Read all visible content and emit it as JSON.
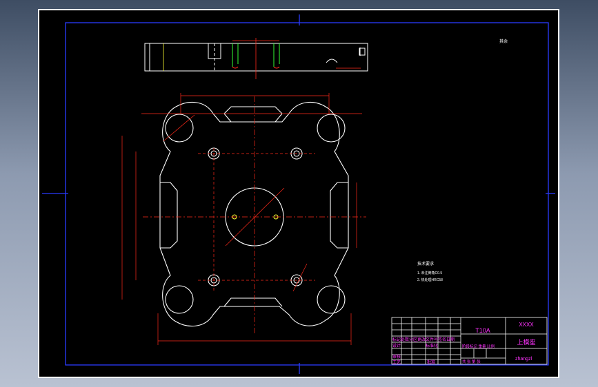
{
  "drawing": {
    "material": "T10A",
    "drawing_no": "XXXX",
    "part_name": "上模座",
    "author": "zhangzl",
    "scale_note": "其余",
    "tech_req_title": "技术要求",
    "tech_req_1": "1. 未注倒角C0.5",
    "tech_req_2": "2. 热处理HRC58",
    "tb_row1": "标记处数分区更改文件号签名日期",
    "tb_row2_left": "设计",
    "tb_row2_mid": "标准化",
    "tb_row3_left": "审核",
    "tb_row4_left": "工艺",
    "tb_row4_mid": "批准",
    "tb_stage": "阶段标记 重量 比例",
    "tb_sheet": "共 张 第 张"
  },
  "colors": {
    "background": "#000000",
    "border": "#ffffff",
    "frame": "#2a3bff",
    "geometry": "#ffffff",
    "dimension": "#ff2a1a",
    "centerline": "#ff2a1a",
    "hidden": "#ffff33",
    "title_block": "#ff33ff",
    "accent_green": "#33ff33"
  }
}
